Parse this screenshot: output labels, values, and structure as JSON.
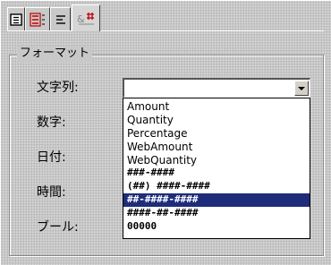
{
  "tabs": [
    {
      "label": "",
      "icon": "document-icon",
      "color": "#000000"
    },
    {
      "label": "",
      "icon": "list-icon",
      "color": "#c00000"
    },
    {
      "label": "",
      "icon": "lines-icon",
      "color": "#000000"
    },
    {
      "label": "",
      "icon": "format-icon",
      "color": "#c00000"
    }
  ],
  "group": {
    "title": "フォーマット",
    "rows": [
      {
        "label": "文字列:"
      },
      {
        "label": "数字:"
      },
      {
        "label": "日付:"
      },
      {
        "label": "時間:"
      },
      {
        "label": "ブール:"
      }
    ]
  },
  "combo": {
    "value": "",
    "options": [
      {
        "label": "Amount",
        "selected": false
      },
      {
        "label": "Quantity",
        "selected": false
      },
      {
        "label": "Percentage",
        "selected": false
      },
      {
        "label": "WebAmount",
        "selected": false
      },
      {
        "label": "WebQuantity",
        "selected": false
      },
      {
        "label": "###-####",
        "selected": false
      },
      {
        "label": "(##) ####-####",
        "selected": false
      },
      {
        "label": "##-####-####",
        "selected": true
      },
      {
        "label": "####-##-####",
        "selected": false
      },
      {
        "label": "00000",
        "selected": false
      }
    ]
  },
  "colors": {
    "selection": "#1e2c7a",
    "panel": "#c8c8c8"
  }
}
